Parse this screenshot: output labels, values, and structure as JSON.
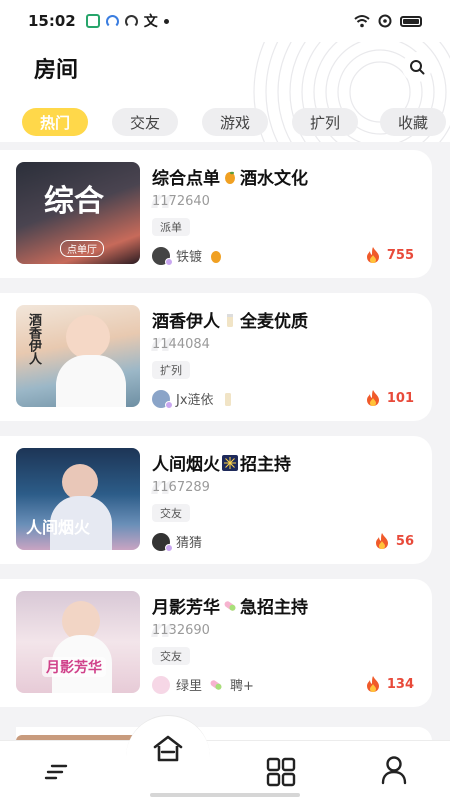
{
  "status_bar": {
    "time": "15:02",
    "ime_icon": "文"
  },
  "header": {
    "title": "房间"
  },
  "tabs": [
    {
      "label": "热门",
      "active": true
    },
    {
      "label": "交友",
      "active": false
    },
    {
      "label": "游戏",
      "active": false
    },
    {
      "label": "扩列",
      "active": false
    },
    {
      "label": "收藏",
      "active": false
    }
  ],
  "rooms": [
    {
      "name": "综合点单",
      "name_suffix": "酒水文化",
      "id": "1172640",
      "tag": "派单",
      "host": "铁镀",
      "heat": "755",
      "cover_text": "综合",
      "cover_sub": "点单厅",
      "emoji": "mango-emoji"
    },
    {
      "name": "酒香伊人",
      "name_suffix": "全麦优质",
      "id": "1144084",
      "tag": "扩列",
      "host": "Jx涟依",
      "heat": "101",
      "cover_text": "酒香伊人",
      "cover_sub": "",
      "emoji": "beer-emoji"
    },
    {
      "name": "人间烟火",
      "name_suffix": "招主持",
      "id": "1167289",
      "tag": "交友",
      "host": "猜猜",
      "heat": "56",
      "cover_text": "人间烟火",
      "cover_sub": "",
      "emoji": "firework-emoji"
    },
    {
      "name": "月影芳华",
      "name_suffix": "急招主持",
      "id": "1132690",
      "tag": "交友",
      "host": "绿里",
      "host_suffix": "聘+",
      "heat": "134",
      "cover_text": "月影芳华",
      "cover_sub": "",
      "emoji": "pill-emoji"
    }
  ],
  "bottom_nav": [
    {
      "icon": "menu-icon"
    },
    {
      "icon": "home-icon",
      "active": true
    },
    {
      "icon": "grid-icon"
    },
    {
      "icon": "user-icon"
    }
  ],
  "colors": {
    "accent": "#ffd84a",
    "heat": "#e84a3a",
    "background": "#f3f3f5"
  }
}
